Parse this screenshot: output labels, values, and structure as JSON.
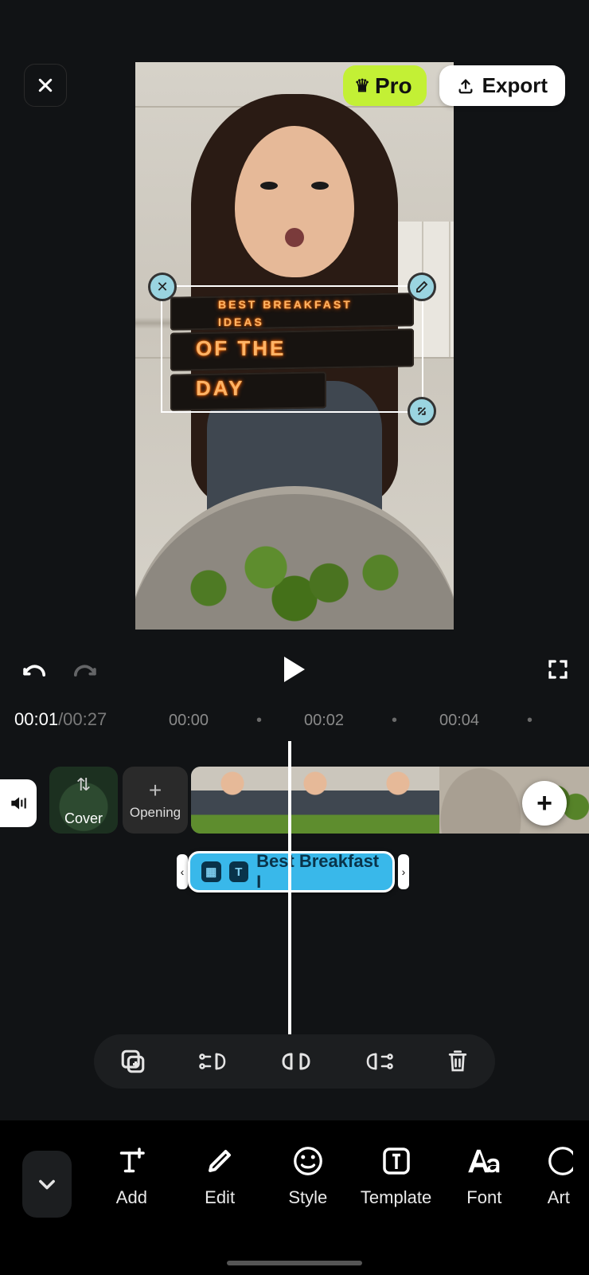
{
  "top": {
    "pro_label": "Pro",
    "export_label": "Export"
  },
  "overlay_text": {
    "line1": "BEST BREAKFAST",
    "line2": "IDEAS",
    "line3": "OF THE",
    "line4": "DAY"
  },
  "playback": {
    "current": "00:01",
    "total": "/00:27"
  },
  "ruler": {
    "t0": "00:00",
    "t2": "00:02",
    "t4": "00:04"
  },
  "timeline": {
    "cover_label": "Cover",
    "opening_label": "Opening",
    "text_clip_label": "Best Breakfast I"
  },
  "bottom_tools": {
    "add": "Add",
    "edit": "Edit",
    "style": "Style",
    "template": "Template",
    "font": "Font",
    "art": "Art"
  }
}
